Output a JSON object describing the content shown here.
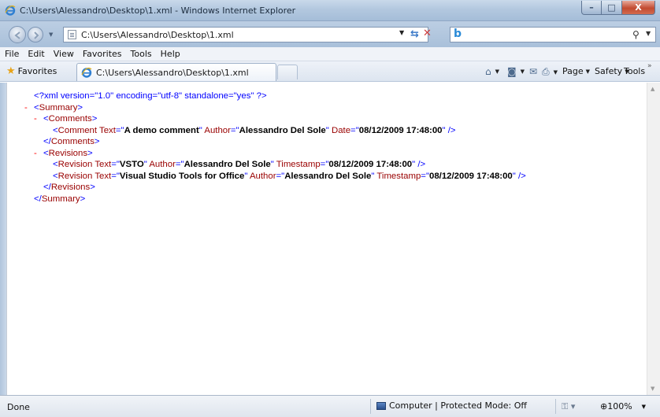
{
  "window": {
    "title": "C:\\Users\\Alessandro\\Desktop\\1.xml - Windows Internet Explorer",
    "controls": {
      "minimize": "–",
      "maximize": "□",
      "close": "X"
    }
  },
  "address_bar": {
    "url": "C:\\Users\\Alessandro\\Desktop\\1.xml",
    "search_provider_icon": "bing-icon",
    "search_value": ""
  },
  "menu": {
    "items": [
      "File",
      "Edit",
      "View",
      "Favorites",
      "Tools",
      "Help"
    ]
  },
  "favorites_bar": {
    "favorites_label": "Favorites",
    "tab_title": "C:\\Users\\Alessandro\\Desktop\\1.xml",
    "commands": [
      "Page",
      "Safety",
      "Tools"
    ]
  },
  "xml": {
    "declaration": "<?xml version=\"1.0\" encoding=\"utf-8\" standalone=\"yes\" ?>",
    "root_tag": "Summary",
    "comments_tag": "Comments",
    "comment_tag": "Comment",
    "comment": {
      "Text": "A demo comment",
      "Author": "Alessandro Del Sole",
      "Date": "08/12/2009 17:48:00"
    },
    "revisions_tag": "Revisions",
    "revision_tag": "Revision",
    "revisions": [
      {
        "Text": "VSTO",
        "Author": "Alessandro Del Sole",
        "Timestamp": "08/12/2009 17:48:00"
      },
      {
        "Text": "Visual Studio Tools for Office",
        "Author": "Alessandro Del Sole",
        "Timestamp": "08/12/2009 17:48:00"
      }
    ],
    "attr_names": {
      "text": "Text",
      "author": "Author",
      "date": "Date",
      "timestamp": "Timestamp"
    }
  },
  "status_bar": {
    "status": "Done",
    "zone": "Computer | Protected Mode: Off",
    "zoom": "100%"
  },
  "colors": {
    "tag": "#990000",
    "markup": "#0000ff",
    "minus": "#ff0000",
    "attr_value": "#000000"
  }
}
